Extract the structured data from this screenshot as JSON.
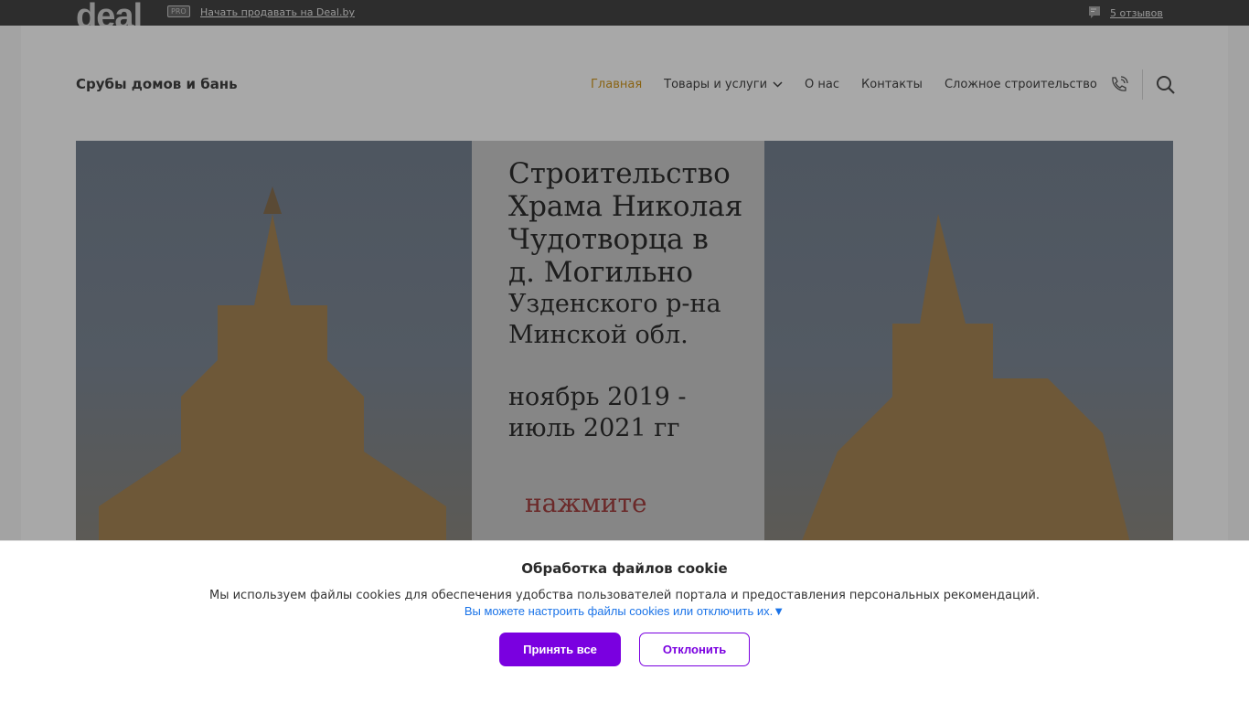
{
  "topbar": {
    "logo": "deal",
    "pro": "PRO",
    "sell_link": "Начать продавать на Deal.by",
    "reviews": "5 отзывов"
  },
  "header": {
    "brand": "Срубы домов и бань",
    "nav": [
      "Главная",
      "Товары и услуги",
      "О нас",
      "Контакты",
      "Сложное строительство"
    ]
  },
  "banner": {
    "title_lines": [
      "Строительство",
      "Храма Николая",
      "Чудотворца в",
      "д. Могильно"
    ],
    "sub_lines": [
      "Узденского р-на",
      "Минской обл."
    ],
    "dates": [
      "ноябрь 2019 -",
      "июль 2021 гг"
    ],
    "cta": "нажмите"
  },
  "cookie": {
    "title": "Обработка файлов cookie",
    "text": "Мы используем файлы cookies для обеспечения удобства пользователей портала и предоставления персональных рекомендаций.",
    "link": "Вы можете настроить файлы cookies или отключить их.▼",
    "accept": "Принять все",
    "decline": "Отклонить"
  }
}
